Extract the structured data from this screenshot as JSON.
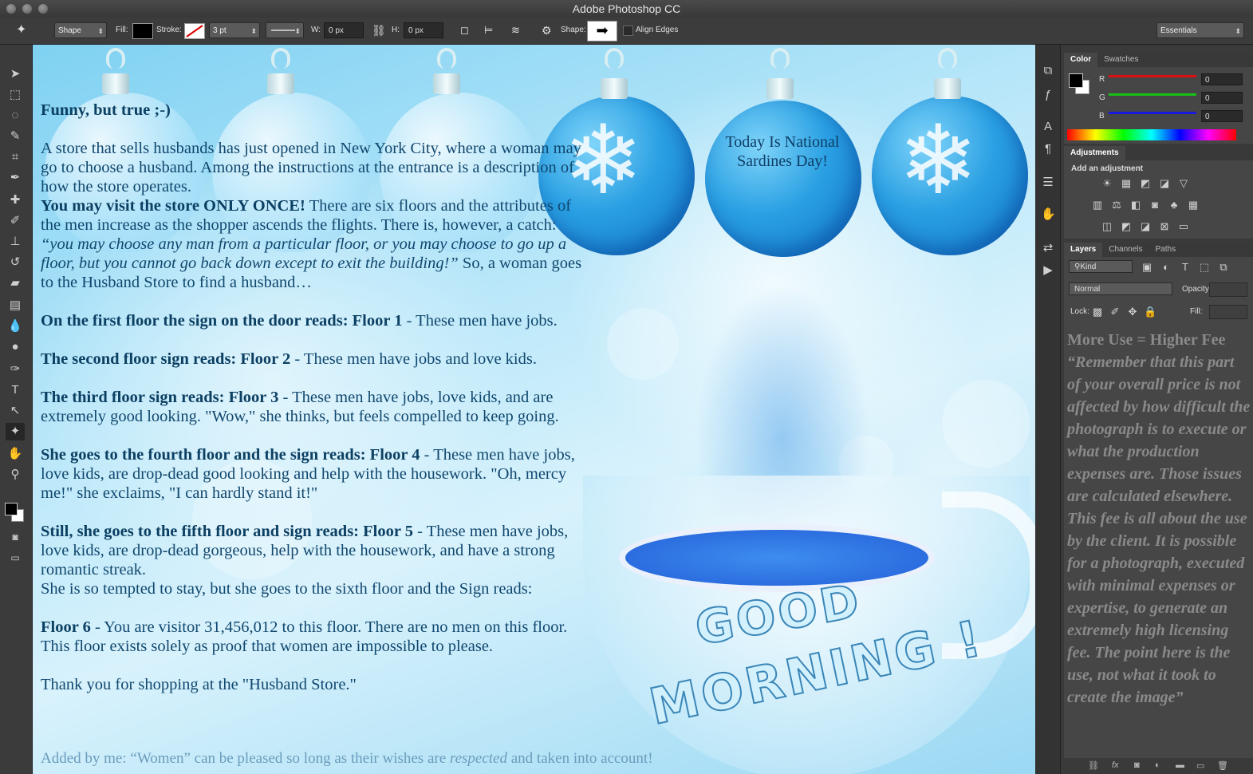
{
  "window": {
    "title": "Adobe Photoshop CC"
  },
  "options": {
    "mode": "Shape",
    "fill_label": "Fill:",
    "stroke_label": "Stroke:",
    "stroke_size": "3 pt",
    "w_label": "W:",
    "w_value": "0 px",
    "h_label": "H:",
    "h_value": "0 px",
    "shape_label": "Shape:",
    "align_edges": "Align Edges",
    "workspace": "Essentials"
  },
  "canvas": {
    "ornament_text": "Today Is National Sardines Day!",
    "greeting_line1": "GOOD",
    "greeting_line2": "MORNING !",
    "story": {
      "heading": "Funny, but true ;-)",
      "intro": "A store that sells husbands has just opened in New York City, where a woman may go to choose a husband. Among the instructions at the entrance is a description of how the store operates.",
      "rule_bold": "You may visit the store ONLY ONCE!",
      "rule_text": " There are six floors and the attributes of the men increase as the shopper ascends the flights. There is, however, a catch: ",
      "rule_italic": "“you may choose any man from a particular floor, or you may choose to go up a floor, but you cannot go back down except to exit the building!”",
      "rule_end": " So, a woman goes to the Husband Store to find a husband…",
      "f1_bold": "On the first floor the sign on the door reads: Floor 1",
      "f1_text": " - These men have jobs.",
      "f2_bold": "The second floor sign reads: Floor 2",
      "f2_text": " - These men have jobs and love kids.",
      "f3_bold": "The third floor sign reads: Floor 3",
      "f3_text": " - These men have jobs, love kids, and are extremely good looking. \"Wow,\" she thinks, but feels compelled to keep going.",
      "f4_bold": "She goes to the fourth floor and the sign reads: Floor 4",
      "f4_text": " - These men have jobs, love kids, are drop-dead good looking and help with the housework. \"Oh, mercy me!\" she exclaims, \"I can hardly stand it!\"",
      "f5_bold": "Still, she goes to the fifth floor and sign reads: Floor 5",
      "f5_text": " - These men have jobs, love kids, are drop-dead gorgeous, help with the housework, and have a strong romantic streak.",
      "f5_after": "She is so tempted to stay, but she goes to the sixth floor and the Sign reads:",
      "f6_bold": "Floor 6",
      "f6_text": " - You are visitor 31,456,012 to this floor. There are no men on this floor. This floor exists solely as proof that women are impossible to please.",
      "thanks": "Thank you for shopping at the \"Husband Store.\"",
      "added_a": "Added by me: “Women” can be pleased so long as their wishes are ",
      "added_i": "respected",
      "added_b": " and taken into account!"
    }
  },
  "color_panel": {
    "tab_color": "Color",
    "tab_swatches": "Swatches",
    "r_label": "R",
    "r_value": "0",
    "g_label": "G",
    "g_value": "0",
    "b_label": "B",
    "b_value": "0"
  },
  "adjustments_panel": {
    "title": "Adjustments",
    "subtitle": "Add an adjustment"
  },
  "layers_panel": {
    "tab_layers": "Layers",
    "tab_channels": "Channels",
    "tab_paths": "Paths",
    "kind": "Kind",
    "blend": "Normal",
    "opacity_label": "Opacity:",
    "lock_label": "Lock:",
    "fill_label": "Fill:",
    "overlay_title": "More Use = Higher Fee",
    "overlay_quote": "“Remember that this part of your overall price is not affected by how difficult the photograph is to execute or what the production expenses are. Those issues are calculated elsewhere. This fee is all about the use by the client. It is possible for a photograph, executed with minimal expenses or expertise, to generate an extremely high licensing fee. The point here is the use, not what it took to create the image”"
  },
  "colors": {
    "accent": "#2aa0e3",
    "text_blue": "#10476e"
  }
}
